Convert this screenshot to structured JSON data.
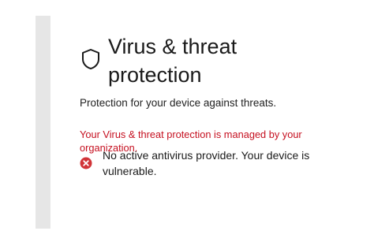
{
  "header": {
    "title": "Virus & threat protection",
    "icon": "shield-icon"
  },
  "subtitle": "Protection for your device against threats.",
  "managed_notice": "Your Virus & threat protection is managed by your organization.",
  "status": {
    "icon": "error-icon",
    "text": "No active antivirus provider. Your device is vulnerable."
  },
  "colors": {
    "notice": "#c50f1f",
    "error_icon": "#d13438",
    "strip": "#e6e6e6"
  }
}
